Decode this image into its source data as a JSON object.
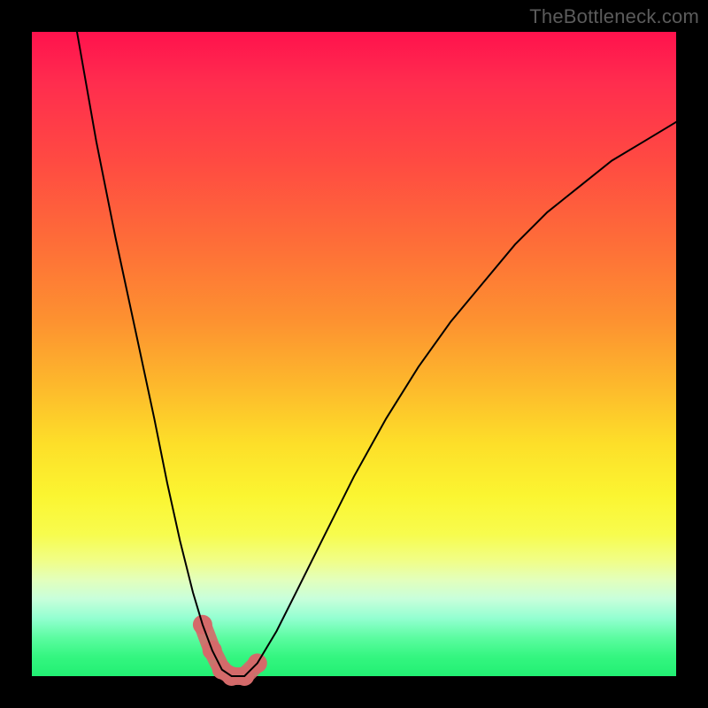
{
  "watermark": "TheBottleneck.com",
  "colors": {
    "frame": "#000000",
    "curve": "#000000",
    "band": "#d46a6a",
    "gradient_top": "#ff124d",
    "gradient_bottom": "#22ef73"
  },
  "chart_data": {
    "type": "line",
    "title": "",
    "xlabel": "",
    "ylabel": "",
    "xlim": [
      0,
      100
    ],
    "ylim": [
      0,
      100
    ],
    "x": [
      7,
      10,
      13,
      16,
      19,
      21,
      23,
      25,
      26.5,
      28,
      29.5,
      31,
      33,
      35,
      38,
      41,
      45,
      50,
      55,
      60,
      65,
      70,
      75,
      80,
      85,
      90,
      95,
      100
    ],
    "values": [
      100,
      83,
      68,
      54,
      40,
      30,
      21,
      13,
      8,
      4,
      1,
      0,
      0,
      2,
      7,
      13,
      21,
      31,
      40,
      48,
      55,
      61,
      67,
      72,
      76,
      80,
      83,
      86
    ],
    "annotations": [],
    "highlight_band": {
      "x": [
        26.5,
        28,
        29.5,
        31,
        33,
        35
      ],
      "values": [
        8,
        4,
        1,
        0,
        0,
        2
      ]
    }
  }
}
